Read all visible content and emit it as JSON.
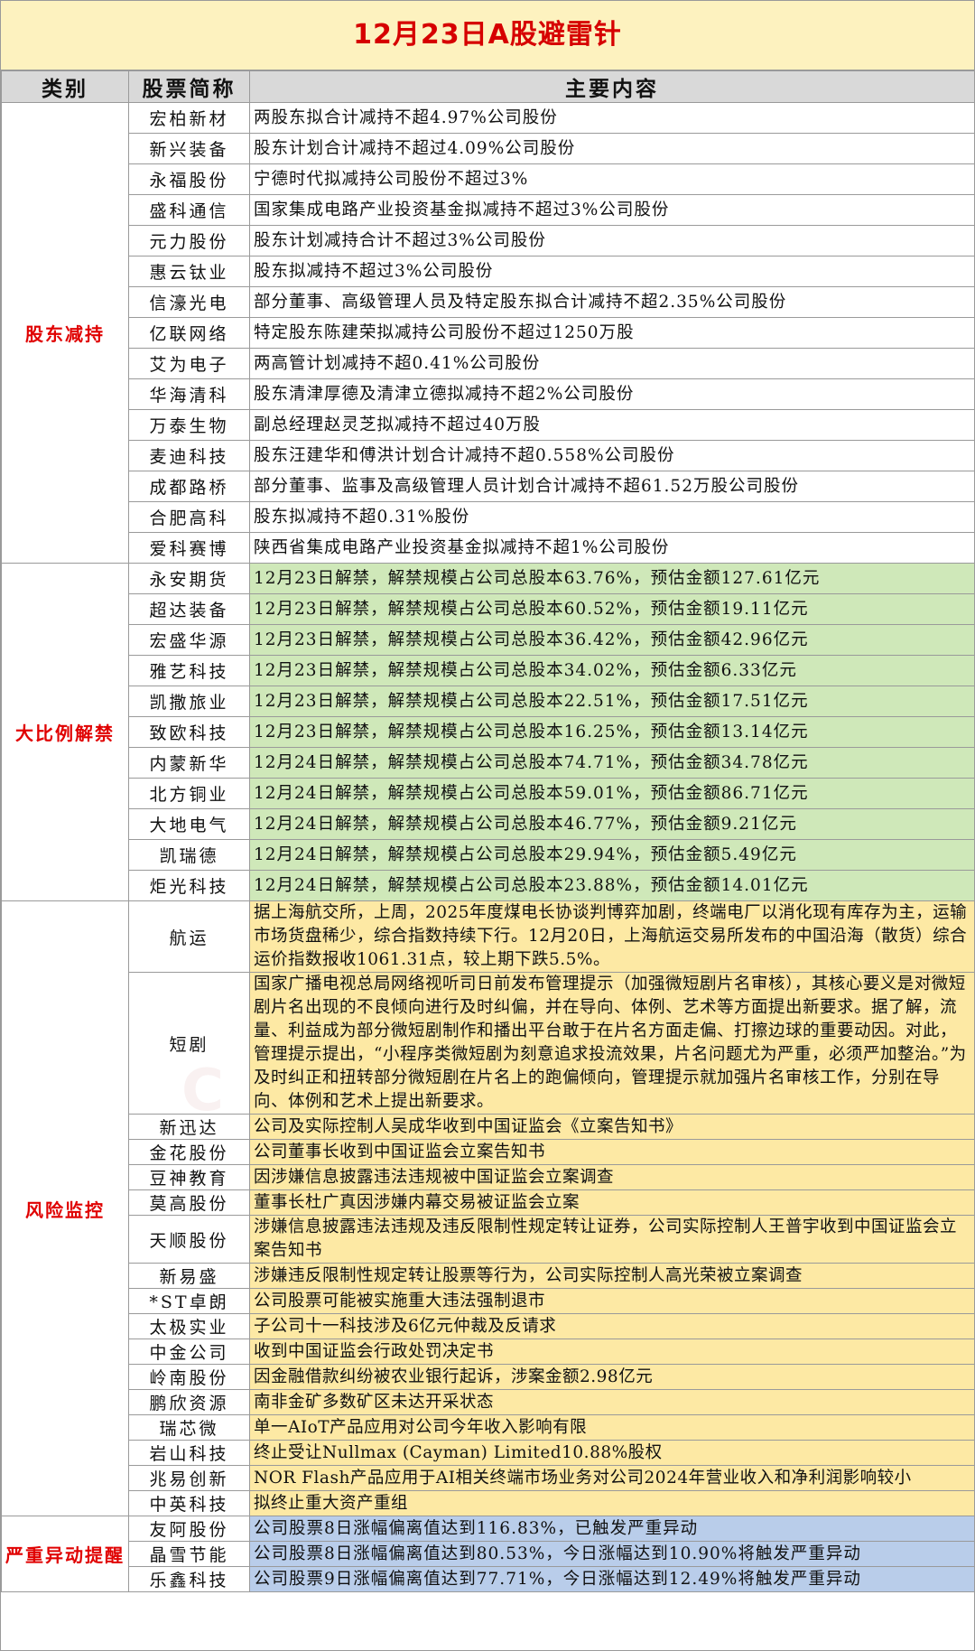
{
  "title": "12月23日A股避雷针",
  "headers": [
    "类别",
    "股票简称",
    "主要内容"
  ],
  "sections": [
    {
      "category": "股东减持",
      "rows": [
        {
          "name": "宏柏新材",
          "content": "两股东拟合计减持不超4.97%公司股份"
        },
        {
          "name": "新兴装备",
          "content": "股东计划合计减持不超过4.09%公司股份"
        },
        {
          "name": "永福股份",
          "content": "宁德时代拟减持公司股份不超过3%"
        },
        {
          "name": "盛科通信",
          "content": "国家集成电路产业投资基金拟减持不超过3%公司股份"
        },
        {
          "name": "元力股份",
          "content": "股东计划减持合计不超过3%公司股份"
        },
        {
          "name": "惠云钛业",
          "content": "股东拟减持不超过3%公司股份"
        },
        {
          "name": "信濠光电",
          "content": "部分董事、高级管理人员及特定股东拟合计减持不超2.35%公司股份"
        },
        {
          "name": "亿联网络",
          "content": "特定股东陈建荣拟减持公司股份不超过1250万股"
        },
        {
          "name": "艾为电子",
          "content": "两高管计划减持不超0.41%公司股份"
        },
        {
          "name": "华海清科",
          "content": "股东清津厚德及清津立德拟减持不超2%公司股份"
        },
        {
          "name": "万泰生物",
          "content": "副总经理赵灵芝拟减持不超过40万股"
        },
        {
          "name": "麦迪科技",
          "content": "股东汪建华和傅洪计划合计减持不超0.558%公司股份"
        },
        {
          "name": "成都路桥",
          "content": "部分董事、监事及高级管理人员计划合计减持不超61.52万股公司股份"
        },
        {
          "name": "合肥高科",
          "content": "股东拟减持不超0.31%股份"
        },
        {
          "name": "爱科赛博",
          "content": "陕西省集成电路产业投资基金拟减持不超1%公司股份"
        }
      ]
    },
    {
      "category": "大比例解禁",
      "rows": [
        {
          "name": "永安期货",
          "content": "12月23日解禁，解禁规模占公司总股本63.76%，预估金额127.61亿元"
        },
        {
          "name": "超达装备",
          "content": "12月23日解禁，解禁规模占公司总股本60.52%，预估金额19.11亿元"
        },
        {
          "name": "宏盛华源",
          "content": "12月23日解禁，解禁规模占公司总股本36.42%，预估金额42.96亿元"
        },
        {
          "name": "雅艺科技",
          "content": "12月23日解禁，解禁规模占公司总股本34.02%，预估金额6.33亿元"
        },
        {
          "name": "凯撒旅业",
          "content": "12月23日解禁，解禁规模占公司总股本22.51%，预估金额17.51亿元"
        },
        {
          "name": "致欧科技",
          "content": "12月23日解禁，解禁规模占公司总股本16.25%，预估金额13.14亿元"
        },
        {
          "name": "内蒙新华",
          "content": "12月24日解禁，解禁规模占公司总股本74.71%，预估金额34.78亿元"
        },
        {
          "name": "北方铜业",
          "content": "12月24日解禁，解禁规模占公司总股本59.01%，预估金额86.71亿元"
        },
        {
          "name": "大地电气",
          "content": "12月24日解禁，解禁规模占公司总股本46.77%，预估金额9.21亿元"
        },
        {
          "name": "凯瑞德",
          "content": "12月24日解禁，解禁规模占公司总股本29.94%，预估金额5.49亿元"
        },
        {
          "name": "炬光科技",
          "content": "12月24日解禁，解禁规模占公司总股本23.88%，预估金额14.01亿元"
        }
      ]
    },
    {
      "category": "风险监控",
      "rows": [
        {
          "name": "航运",
          "content": "据上海航交所，上周，2025年度煤电长协谈判博弈加剧，终端电厂以消化现有库存为主，运输市场货盘稀少，综合指数持续下行。12月20日，上海航运交易所发布的中国沿海（散货）综合运价指数报收1061.31点，较上期下跌5.5%。"
        },
        {
          "name": "短剧",
          "content": "国家广播电视总局网络视听司日前发布管理提示（加强微短剧片名审核），其核心要义是对微短剧片名出现的不良倾向进行及时纠偏，并在导向、体例、艺术等方面提出新要求。据了解，流量、利益成为部分微短剧制作和播出平台敢于在片名方面走偏、打擦边球的重要动因。对此，管理提示提出，“小程序类微短剧为刻意追求投流效果，片名问题尤为严重，必须严加整治。”为及时纠正和扭转部分微短剧在片名上的跑偏倾向，管理提示就加强片名审核工作，分别在导向、体例和艺术上提出新要求。"
        },
        {
          "name": "新迅达",
          "content": "公司及实际控制人吴成华收到中国证监会《立案告知书》"
        },
        {
          "name": "金花股份",
          "content": "公司董事长收到中国证监会立案告知书"
        },
        {
          "name": "豆神教育",
          "content": "因涉嫌信息披露违法违规被中国证监会立案调查"
        },
        {
          "name": "莫高股份",
          "content": "董事长杜广真因涉嫌内幕交易被证监会立案"
        },
        {
          "name": "天顺股份",
          "content": "涉嫌信息披露违法违规及违反限制性规定转让证券，公司实际控制人王普宇收到中国证监会立案告知书"
        },
        {
          "name": "新易盛",
          "content": "涉嫌违反限制性规定转让股票等行为，公司实际控制人高光荣被立案调查"
        },
        {
          "name": "*ST卓朗",
          "content": "公司股票可能被实施重大违法强制退市"
        },
        {
          "name": "太极实业",
          "content": "子公司十一科技涉及6亿元仲裁及反请求"
        },
        {
          "name": "中金公司",
          "content": "收到中国证监会行政处罚决定书"
        },
        {
          "name": "岭南股份",
          "content": "因金融借款纠纷被农业银行起诉，涉案金额2.98亿元"
        },
        {
          "name": "鹏欣资源",
          "content": "南非金矿多数矿区未达开采状态"
        },
        {
          "name": "瑞芯微",
          "content": "单一AIoT产品应用对公司今年收入影响有限"
        },
        {
          "name": "岩山科技",
          "content": "终止受让Nullmax (Cayman) Limited10.88%股权"
        },
        {
          "name": "兆易创新",
          "content": "NOR Flash产品应用于AI相关终端市场业务对公司2024年营业收入和净利润影响较小"
        },
        {
          "name": "中英科技",
          "content": "拟终止重大资产重组"
        }
      ]
    },
    {
      "category": "严重异动提醒",
      "rows": [
        {
          "name": "友阿股份",
          "content": "公司股票8日涨幅偏离值达到116.83%，已触发严重异动"
        },
        {
          "name": "晶雪节能",
          "content": "公司股票8日涨幅偏离值达到80.53%，今日涨幅达到10.90%将触发严重异动"
        },
        {
          "name": "乐鑫科技",
          "content": "公司股票9日涨幅偏离值达到77.71%，今日涨幅达到12.49%将触发严重异动"
        }
      ]
    }
  ]
}
